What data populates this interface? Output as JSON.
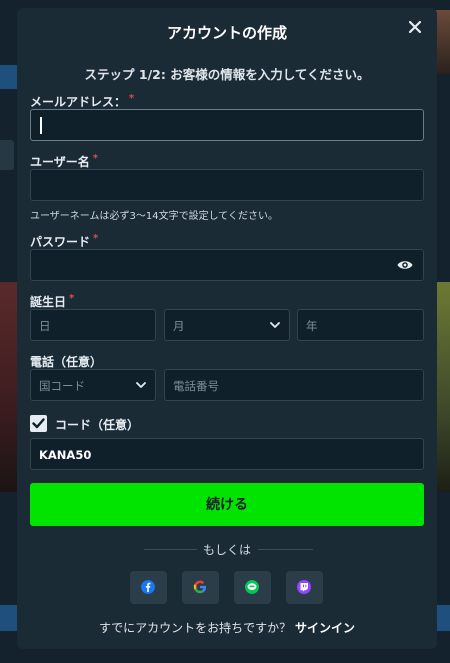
{
  "modal": {
    "title": "アカウントの作成",
    "close_icon": "close-icon",
    "step": "ステップ 1/2: お客様の情報を入力してください。"
  },
  "form": {
    "email_label": "メールアドレス：",
    "username_label": "ユーザー名",
    "username_hint": "ユーザーネームは必ず3〜14文字で設定してください。",
    "password_label": "パスワード",
    "birthdate_label": "誕生日",
    "day_placeholder": "日",
    "month_placeholder": "月",
    "year_placeholder": "年",
    "phone_label": "電話（任意）",
    "country_code_placeholder": "国コード",
    "phone_placeholder": "電話番号",
    "code_label": "コード（任意）",
    "code_checked": true,
    "code_value": "KANA50",
    "required_mark": "*"
  },
  "actions": {
    "continue_label": "続ける",
    "or_label": "もしくは",
    "signin_prompt": "すでにアカウントをお持ちですか？",
    "signin_link": "サインイン"
  },
  "social": [
    {
      "icon": "facebook-icon",
      "color": "#1877f2"
    },
    {
      "icon": "google-icon",
      "color": "#4285f4"
    },
    {
      "icon": "line-icon",
      "color": "#06c755"
    },
    {
      "icon": "twitch-icon",
      "color": "#9146ff"
    }
  ],
  "colors": {
    "accent_button": "#00e400",
    "modal_bg": "#1b2b36",
    "field_bg": "#10202a",
    "required": "#e0475b"
  }
}
